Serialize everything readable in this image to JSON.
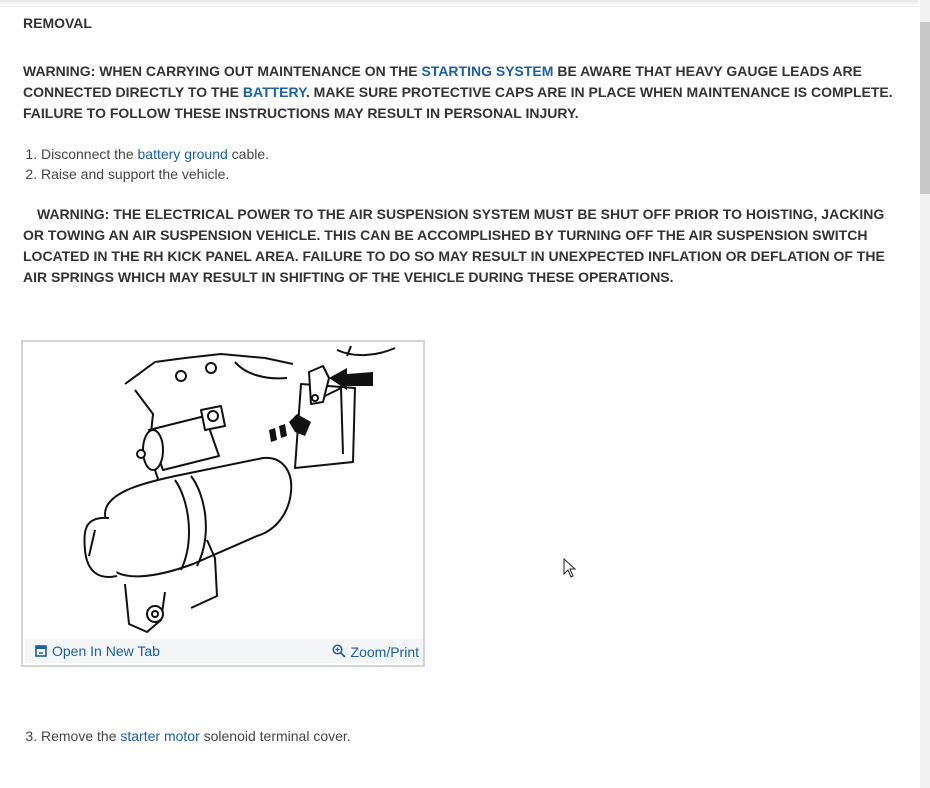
{
  "section": {
    "heading": "REMOVAL"
  },
  "warning1": {
    "pre": "WARNING: WHEN CARRYING OUT MAINTENANCE ON THE ",
    "link1": "STARTING SYSTEM",
    "mid": " BE AWARE THAT HEAVY GAUGE LEADS ARE CONNECTED DIRECTLY TO THE ",
    "link2": "BATTERY",
    "post": ". MAKE SURE PROTECTIVE CAPS ARE IN PLACE WHEN MAINTENANCE IS COMPLETE. FAILURE TO FOLLOW THESE INSTRUCTIONS MAY RESULT IN PERSONAL INJURY."
  },
  "steps_a": [
    {
      "pre": "Disconnect the ",
      "link": "battery ground",
      "post": " cable."
    },
    {
      "pre": "Raise and support the vehicle.",
      "link": "",
      "post": ""
    }
  ],
  "warning2": {
    "text": "WARNING: THE ELECTRICAL POWER TO THE AIR SUSPENSION SYSTEM MUST BE SHUT OFF PRIOR TO HOISTING, JACKING OR TOWING AN AIR SUSPENSION VEHICLE. THIS CAN BE ACCOMPLISHED BY TURNING OFF THE AIR SUSPENSION SWITCH LOCATED IN THE RH KICK PANEL AREA. FAILURE TO DO SO MAY RESULT IN UNEXPECTED INFLATION OR DEFLATION OF THE AIR SPRINGS WHICH MAY RESULT IN SHIFTING OF THE VEHICLE DURING THESE OPERATIONS."
  },
  "figure": {
    "open_label": "Open In New Tab",
    "zoom_label": "Zoom/Print"
  },
  "steps_b": [
    {
      "number": "3",
      "pre": "Remove the ",
      "link": "starter motor",
      "post": " solenoid terminal cover."
    }
  ],
  "colors": {
    "link": "#1a5fa8",
    "text": "#333333"
  }
}
